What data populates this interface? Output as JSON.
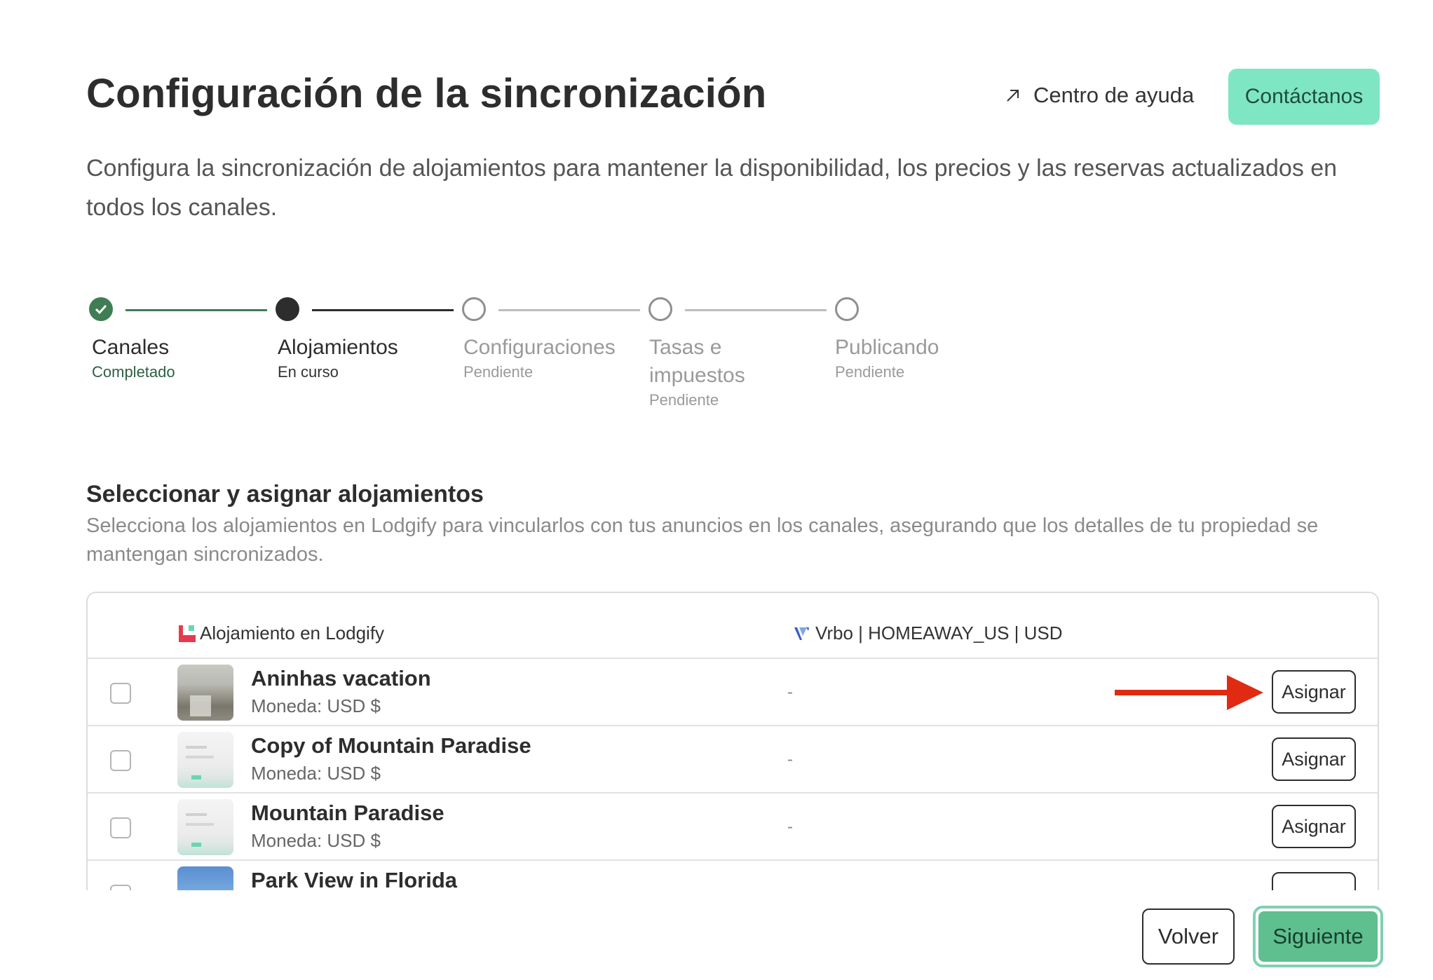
{
  "header": {
    "title": "Configuración de la sincronización",
    "help_link": "Centro de ayuda",
    "contact_button": "Contáctanos",
    "intro": "Configura la sincronización de alojamientos para mantener la disponibilidad, los precios y las reservas actualizados en todos los canales."
  },
  "stepper": {
    "steps": [
      {
        "title": "Canales",
        "status": "Completado",
        "state": "completed"
      },
      {
        "title": "Alojamientos",
        "status": "En curso",
        "state": "current"
      },
      {
        "title": "Configuraciones",
        "status": "Pendiente",
        "state": "pending"
      },
      {
        "title": "Tasas e impuestos",
        "status": "Pendiente",
        "state": "pending"
      },
      {
        "title": "Publicando",
        "status": "Pendiente",
        "state": "pending"
      }
    ]
  },
  "section": {
    "title": "Seleccionar y asignar alojamientos",
    "description": "Selecciona los alojamientos en Lodgify para vincularlos con tus anuncios en los canales, asegurando que los detalles de tu propiedad se mantengan sincronizados."
  },
  "table": {
    "col_lodgify": "Alojamiento en Lodgify",
    "col_channel": "Vrbo | HOMEAWAY_US | USD",
    "rows": [
      {
        "name": "Aninhas vacation",
        "currency": "Moneda: USD $",
        "assigned": "-",
        "button": "Asignar"
      },
      {
        "name": "Copy of Mountain Paradise",
        "currency": "Moneda: USD $",
        "assigned": "-",
        "button": "Asignar"
      },
      {
        "name": "Mountain Paradise",
        "currency": "Moneda: USD $",
        "assigned": "-",
        "button": "Asignar"
      },
      {
        "name": "Park View in Florida",
        "currency": "",
        "assigned": "",
        "button": ""
      }
    ]
  },
  "footer": {
    "back_button": "Volver",
    "next_button": "Siguiente"
  },
  "icons": {
    "help_link_icon": "arrow-up-right-icon",
    "lodgify_logo": "lodgify-logo-icon",
    "vrbo_logo": "vrbo-logo-icon",
    "annotation": "red-arrow-icon"
  },
  "colors": {
    "accent": "#7fe6c3",
    "primary_button": "#5fbf8f",
    "completed_step": "#3f7d55",
    "annotation_arrow": "#e02a12",
    "lodgify_red": "#e8384f"
  }
}
